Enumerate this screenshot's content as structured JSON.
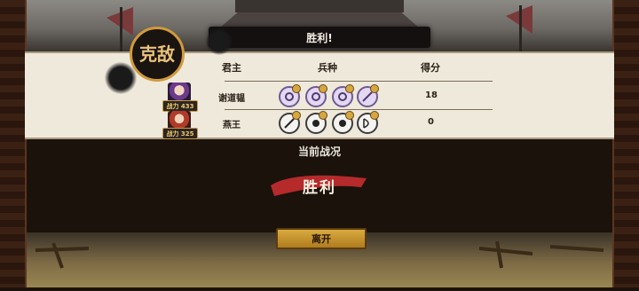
{
  "header": {
    "title": "胜利!"
  },
  "stamp": {
    "text": "克敌"
  },
  "table": {
    "columns": [
      "君主",
      "兵种",
      "得分"
    ],
    "rows": [
      {
        "lord": "谢道韫",
        "power": "战力 433",
        "score": "18",
        "units": [
          "violet-sword-icon",
          "violet-sword-icon",
          "violet-sword-icon",
          "violet-spear-icon"
        ]
      },
      {
        "lord": "燕王",
        "power": "战力 325",
        "score": "0",
        "units": [
          "dark-spear-icon",
          "dark-fist-icon",
          "dark-fist-icon",
          "dark-bow-icon"
        ]
      }
    ]
  },
  "battle": {
    "section_title": "当前战况",
    "result": "胜利"
  },
  "actions": {
    "leave_label": "离开"
  },
  "colors": {
    "accent_gold": "#d8aa3f",
    "brush_red": "#b52a2a",
    "panel": "#efe9dc"
  }
}
